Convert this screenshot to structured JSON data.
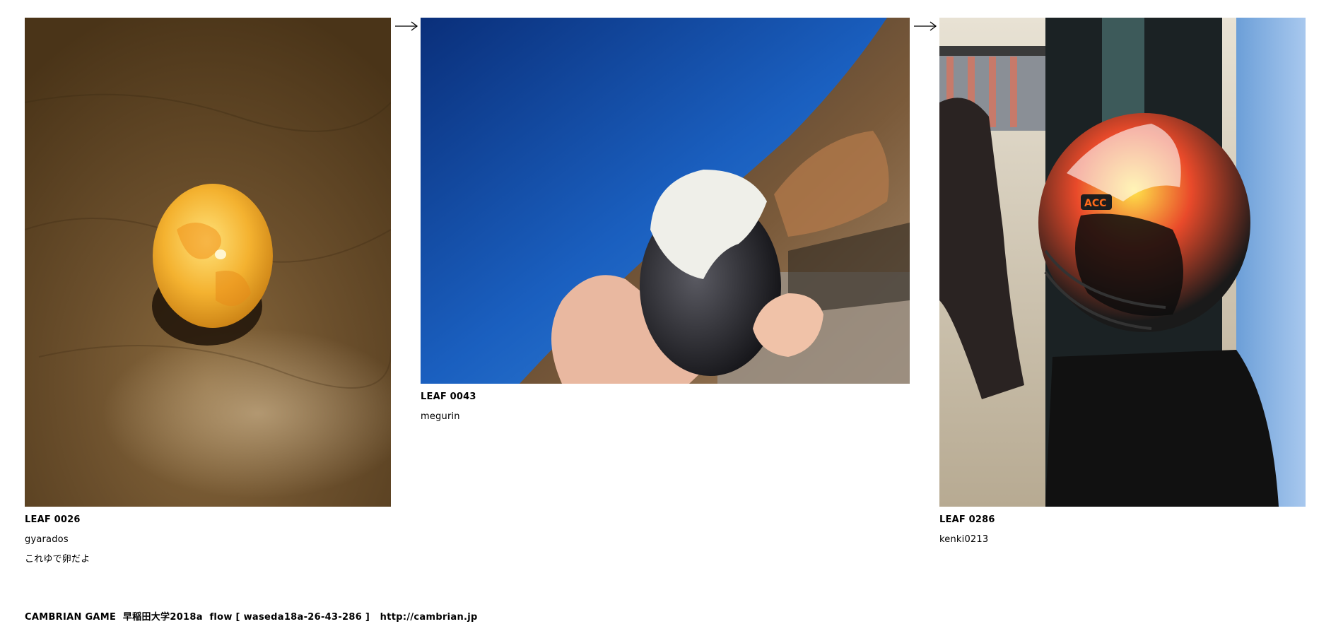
{
  "flow": [
    {
      "leaf": "LEAF 0026",
      "user": "gyarados",
      "comment": "これゆで卵だよ",
      "image": "yellow-egg-on-leather-photo"
    },
    {
      "leaf": "LEAF 0043",
      "user": "megurin",
      "comment": "",
      "image": "black-egg-in-hand-mountain-photo"
    },
    {
      "leaf": "LEAF 0286",
      "user": "kenki0213",
      "comment": "",
      "image": "football-helmet-store-photo"
    }
  ],
  "arrows": [
    "right-arrow-icon",
    "right-arrow-icon"
  ],
  "footer": {
    "text": "CAMBRIAN GAME  早稲田大学2018a  flow [ waseda18a-26-43-286 ]   ",
    "link": "http://cambrian.jp"
  },
  "colors": {
    "background": "#ffffff",
    "text": "#000000"
  }
}
